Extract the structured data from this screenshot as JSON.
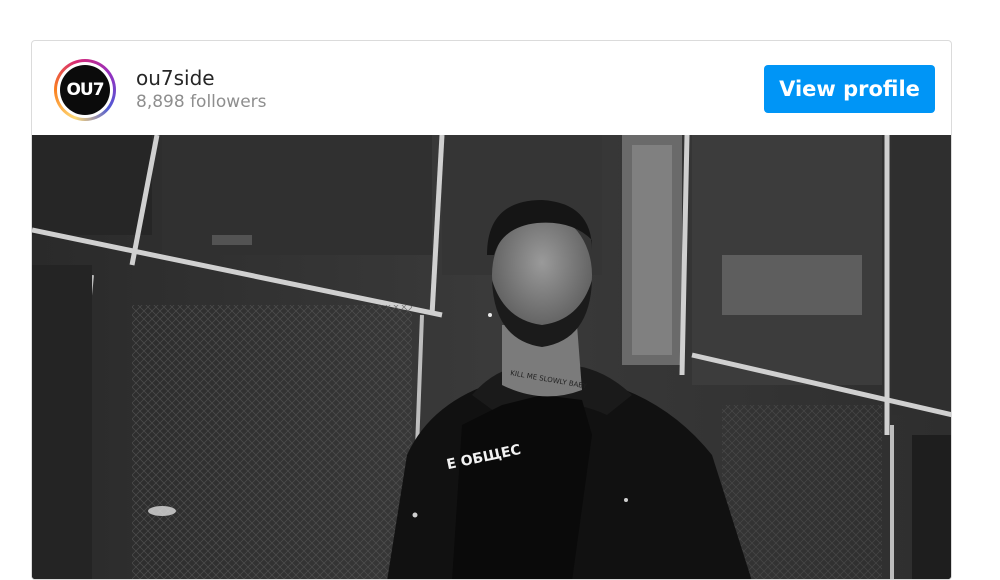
{
  "profile": {
    "avatar_text": "OU7",
    "username": "ou7side",
    "followers": "8,898 followers"
  },
  "actions": {
    "view_profile_label": "View profile"
  },
  "post": {
    "shirt_text": "Е ОБЩЕС",
    "tattoo_text": "KILL ME SLOWLY BABY"
  },
  "colors": {
    "button": "#0095f6",
    "border": "#dbdbdb",
    "username": "#262626",
    "secondary": "#8e8e8e"
  }
}
